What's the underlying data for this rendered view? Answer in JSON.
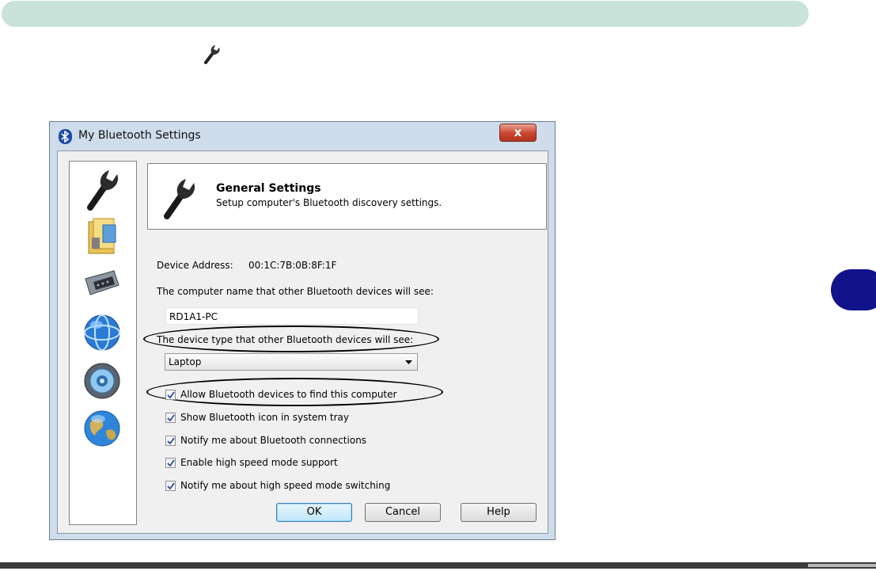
{
  "page": {
    "header_bar_color": "#c9e2da",
    "chapter_tab_color": "#12128a",
    "small_icon": "wrench-icon"
  },
  "dialog": {
    "title": "My Bluetooth Settings",
    "close_label": "x",
    "sidebar_icons": [
      "wrench-icon",
      "folder-icon",
      "serial-port-icon",
      "network-globe-icon",
      "speaker-icon",
      "earth-globe-icon"
    ],
    "header": {
      "title": "General Settings",
      "subtitle": "Setup computer's Bluetooth discovery settings."
    },
    "device_address_label": "Device Address:",
    "device_address_value": "00:1C:7B:0B:8F:1F",
    "computer_name_label": "The computer name that other Bluetooth devices will see:",
    "computer_name_value": "RD1A1-PC",
    "device_type_label": "The device type that other Bluetooth devices will see:",
    "device_type_value": "Laptop",
    "checkboxes": [
      {
        "label": "Allow Bluetooth devices to find this computer",
        "checked": true
      },
      {
        "label": "Show Bluetooth icon in system tray",
        "checked": true
      },
      {
        "label": "Notify me about Bluetooth connections",
        "checked": true
      },
      {
        "label": "Enable high speed mode support",
        "checked": true
      },
      {
        "label": "Notify me about high speed mode switching",
        "checked": true
      }
    ],
    "buttons": {
      "ok": "OK",
      "cancel": "Cancel",
      "help": "Help"
    }
  }
}
